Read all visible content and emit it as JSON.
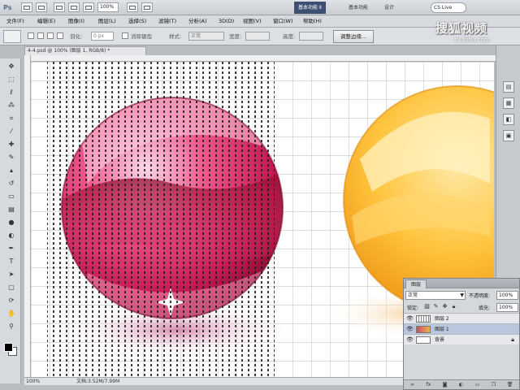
{
  "app": {
    "logo": "Ps",
    "zoom": "100%",
    "workspaces": [
      "基本功能 Ⅱ",
      "基本功能",
      "设计"
    ],
    "cslive": "CS Live"
  },
  "menu": [
    "文件(F)",
    "编辑(E)",
    "图像(I)",
    "图层(L)",
    "选择(S)",
    "滤镜(T)",
    "分析(A)",
    "3D(D)",
    "视图(V)",
    "窗口(W)",
    "帮助(H)"
  ],
  "options": {
    "feather_label": "羽化:",
    "feather_value": "0 px",
    "antialias_label": "消除锯齿",
    "style_label": "样式:",
    "style_value": "正常",
    "width_label": "宽度:",
    "height_label": "高度:",
    "refine_edge": "调整边缘..."
  },
  "document": {
    "tab_title": "4-4.psd @ 100% (图层 1, RGB/8) *",
    "status_zoom": "100%",
    "status_doc": "文档:3.52M/7.99M"
  },
  "watermark": {
    "brand": "搜狐视频",
    "url": "tv.sohu.com"
  },
  "layers_panel": {
    "tab": "图层",
    "blend_mode": "正常",
    "opacity_label": "不透明度:",
    "opacity_value": "100%",
    "lock_label": "锁定:",
    "fill_label": "填充:",
    "fill_value": "100%",
    "layers": [
      {
        "name": "图层 2",
        "selected": false,
        "thumb": "grid"
      },
      {
        "name": "图层 1",
        "selected": true,
        "thumb": "fx"
      },
      {
        "name": "背景",
        "selected": false,
        "thumb": "plain"
      }
    ]
  }
}
